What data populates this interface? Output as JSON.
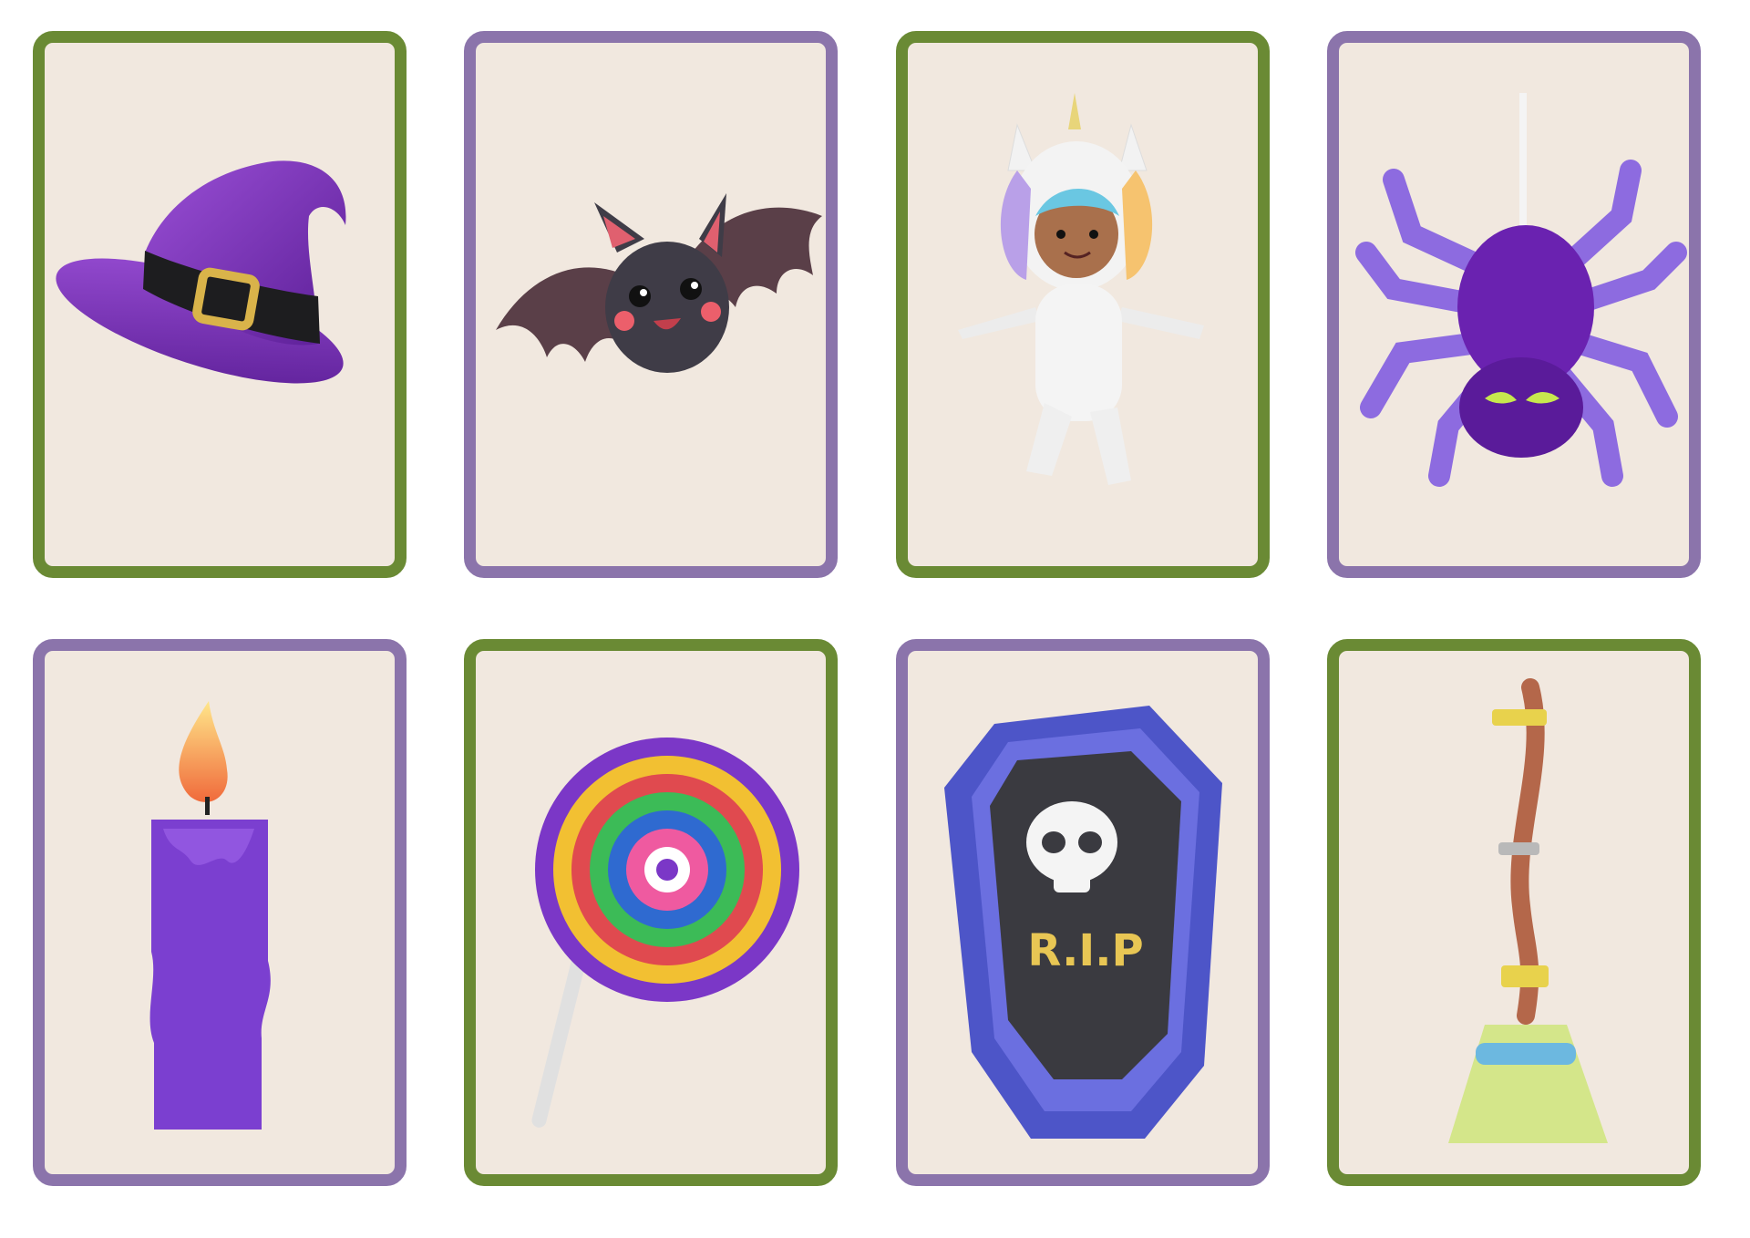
{
  "cards": [
    {
      "icon": "witch-hat-icon",
      "border": "#6a8a34"
    },
    {
      "icon": "bat-icon",
      "border": "#8b74ab"
    },
    {
      "icon": "unicorn-costume-kid-icon",
      "border": "#6a8a34"
    },
    {
      "icon": "spider-icon",
      "border": "#8b74ab"
    },
    {
      "icon": "candle-icon",
      "border": "#8b74ab"
    },
    {
      "icon": "lollipop-icon",
      "border": "#6a8a34"
    },
    {
      "icon": "coffin-icon",
      "border": "#8b74ab"
    },
    {
      "icon": "broom-icon",
      "border": "#6a8a34"
    }
  ],
  "coffin": {
    "label": "R.I.P"
  },
  "colors": {
    "card_bg": "#f1e8df",
    "green_border": "#6a8a34",
    "purple_border": "#8b74ab"
  }
}
